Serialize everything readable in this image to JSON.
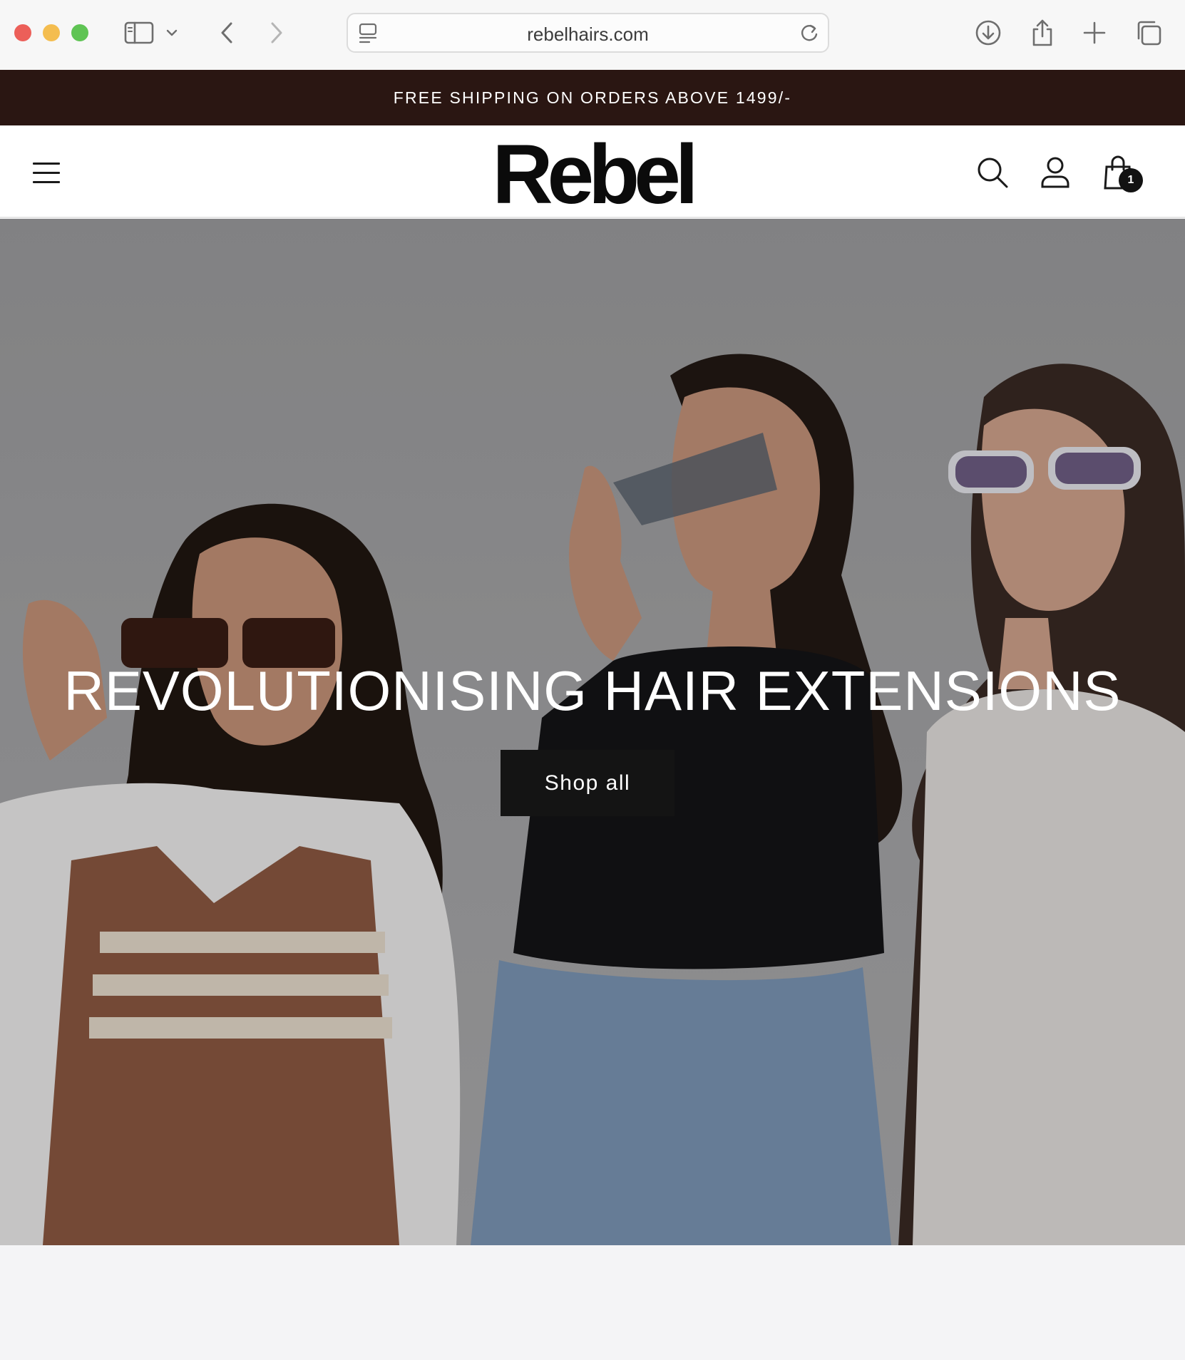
{
  "browser": {
    "url": "rebelhairs.com",
    "icons": [
      "sidebar-icon",
      "chevron-down-icon",
      "back-icon",
      "forward-icon",
      "page-icon",
      "reload-icon",
      "download-icon",
      "share-icon",
      "new-tab-icon",
      "tabs-overview-icon"
    ]
  },
  "announcement": {
    "text": "FREE SHIPPING ON ORDERS ABOVE 1499/-"
  },
  "header": {
    "logo": "Rebel",
    "cart_count": "1",
    "icons": [
      "menu-icon",
      "search-icon",
      "account-icon",
      "cart-icon"
    ]
  },
  "hero": {
    "title": "REVOLUTIONISING HAIR EXTENSIONS",
    "button_label": "Shop all"
  },
  "colors": {
    "announcement_bg": "#2a1612",
    "button_bg": "#141414",
    "header_bg": "#ffffff"
  }
}
